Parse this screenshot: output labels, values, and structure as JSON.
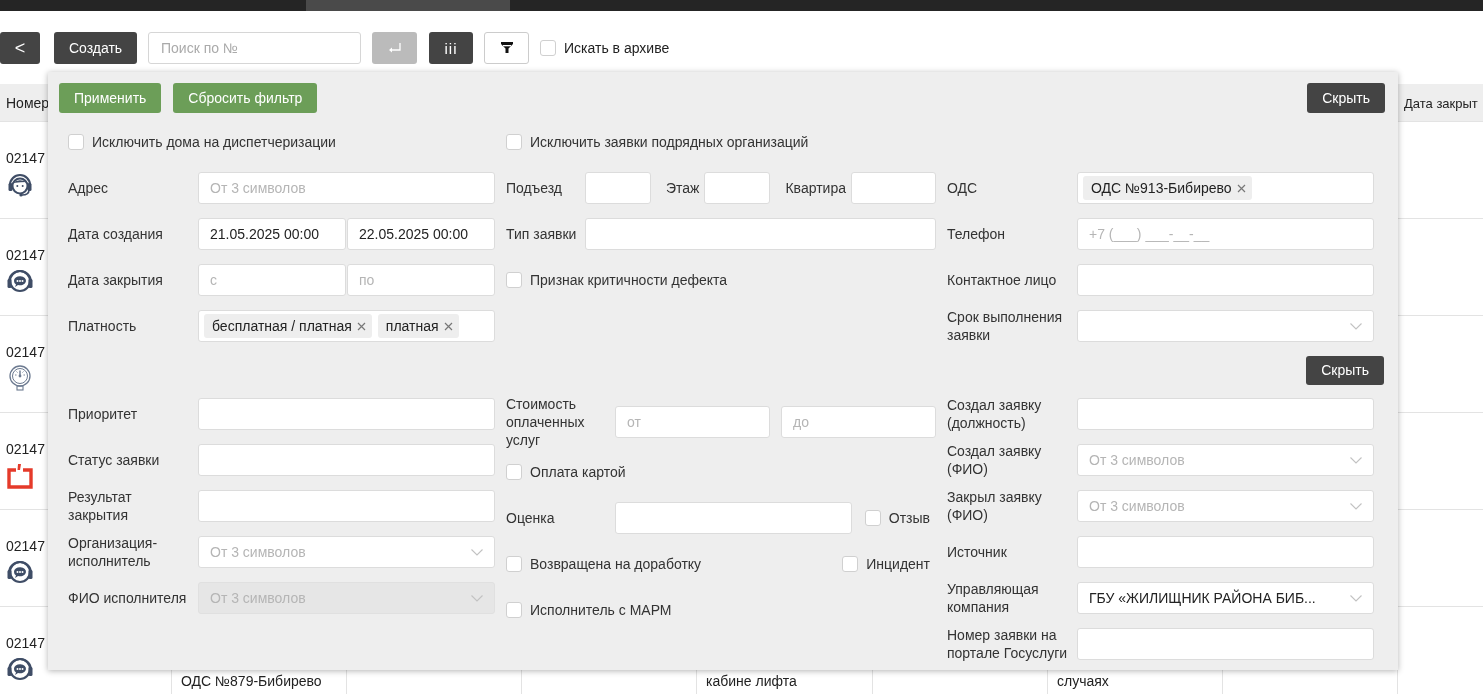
{
  "toolbar": {
    "back_button": "<",
    "create_button": "Создать",
    "search": {
      "placeholder": "Поиск по №"
    },
    "columns_button": "iii",
    "archive": {
      "label": "Искать в архиве",
      "checked": false
    }
  },
  "table": {
    "columns": [
      "Номер",
      "Дата закрыт"
    ],
    "rows": [
      {
        "number": "02147",
        "kind": "headset"
      },
      {
        "number": "02147",
        "kind": "chat"
      },
      {
        "number": "02147",
        "kind": "gauge"
      },
      {
        "number": "02147",
        "kind": "frame"
      },
      {
        "number": "02147",
        "kind": "chat"
      },
      {
        "number": "02147",
        "kind": "chat"
      }
    ],
    "last_row": {
      "column_2": "ОДС №879-Бибирево",
      "column_5": "кабине лифта",
      "column_7": "случаях"
    }
  },
  "filter": {
    "apply_button": "Применить",
    "reset_button": "Сбросить фильтр",
    "hide_button": "Скрыть",
    "columns": [
      {
        "groups": [
          [
            {
              "kind": "checkbox",
              "label": "Исключить дома на диспетчеризации",
              "checked": false
            },
            {
              "kind": "field",
              "label": "Адрес",
              "placeholder": "От 3 символов"
            },
            {
              "kind": "pair",
              "label": "Дата создания",
              "fields": [
                {
                  "value": "21.05.2025 00:00"
                },
                {
                  "value": "22.05.2025 00:00"
                }
              ]
            },
            {
              "kind": "pair",
              "label": "Дата закрытия",
              "fields": [
                {
                  "placeholder": "с"
                },
                {
                  "placeholder": "по"
                }
              ]
            },
            {
              "kind": "tags",
              "label": "Платность",
              "tags": [
                "бесплатная / платная",
                "платная"
              ]
            }
          ],
          [
            {
              "kind": "field",
              "label": "Приоритет"
            },
            {
              "kind": "field",
              "label": "Статус заявки"
            },
            {
              "kind": "field",
              "label": "Результат закрытия"
            },
            {
              "kind": "select",
              "label": "Организация-исполнитель",
              "placeholder": "От 3 символов",
              "disabled": false
            },
            {
              "kind": "select",
              "label": "ФИО исполнителя",
              "placeholder": "От 3 символов",
              "disabled": true
            }
          ]
        ]
      },
      {
        "groups": [
          [
            {
              "kind": "checkbox",
              "label": "Исключить заявки подрядных организаций",
              "checked": false
            },
            {
              "kind": "inline",
              "parts": [
                {
                  "label": "Подъезд"
                },
                {
                  "label": "Этаж"
                },
                {
                  "label": "Квартира"
                }
              ]
            },
            {
              "kind": "field",
              "label": "Тип заявки"
            },
            {
              "kind": "checkbox",
              "label": "Признак критичности дефекта",
              "checked": false
            }
          ],
          [
            {
              "kind": "pair",
              "label": "Стоимость оплаченных услуг",
              "fields": [
                {
                  "placeholder": "от"
                },
                {
                  "placeholder": "до"
                }
              ]
            },
            {
              "kind": "checkbox",
              "label": "Оплата картой",
              "checked": false
            },
            {
              "kind": "field",
              "label": "Оценка",
              "check": {
                "label": "Отзыв",
                "checked": false
              }
            },
            {
              "kind": "checks",
              "checks": [
                {
                  "label": "Возвращена на доработку",
                  "checked": false
                },
                {
                  "label": "Инцидент",
                  "checked": false
                }
              ]
            },
            {
              "kind": "checkbox",
              "label": "Исполнитель с МАРМ",
              "checked": false
            }
          ]
        ]
      },
      {
        "groups": [
          [
            {
              "kind": "tags",
              "label": "ОДС",
              "tags": [
                "ОДС №913-Бибирево"
              ]
            },
            {
              "kind": "field",
              "label": "Телефон",
              "placeholder": "+7 (___) ___-__-__"
            },
            {
              "kind": "field",
              "label": "Контактное лицо"
            },
            {
              "kind": "select",
              "label": "Срок выполнения заявки",
              "disabled": false
            }
          ],
          [
            {
              "kind": "button",
              "label": "Скрыть"
            },
            {
              "kind": "field",
              "label": "Создал заявку (должность)"
            },
            {
              "kind": "select",
              "label": "Создал заявку (ФИО)",
              "placeholder": "От 3 символов",
              "disabled": false
            },
            {
              "kind": "select",
              "label": "Закрыл заявку (ФИО)",
              "placeholder": "От 3 символов",
              "disabled": false
            },
            {
              "kind": "field",
              "label": "Источник"
            },
            {
              "kind": "select",
              "label": "Управляющая компания",
              "value": "ГБУ «ЖИЛИЩНИК РАЙОНА БИБ...",
              "disabled": false
            },
            {
              "kind": "field",
              "label": "Номер заявки на портале Госуслуги"
            }
          ]
        ]
      }
    ]
  }
}
